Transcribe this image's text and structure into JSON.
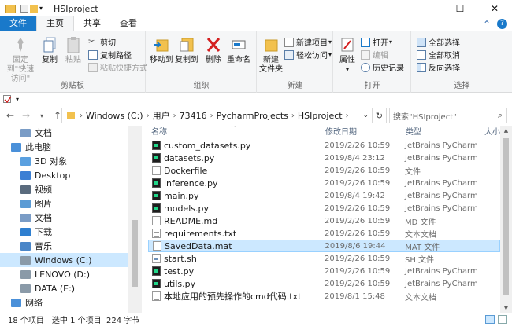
{
  "window": {
    "title": "HSIproject",
    "controls": {
      "minimize": "—",
      "maximize": "☐",
      "close": "✕"
    }
  },
  "ribbon_tabs": [
    "文件",
    "主页",
    "共享",
    "查看"
  ],
  "ribbon": {
    "clipboard": {
      "label": "剪贴板",
      "pin": "固定到\"快速访问\"",
      "copy": "复制",
      "paste": "粘贴",
      "cut": "剪切",
      "copy_path": "复制路径",
      "paste_shortcut": "粘贴快捷方式"
    },
    "organize": {
      "label": "组织",
      "move_to": "移动到",
      "copy_to": "复制到",
      "delete": "删除",
      "rename": "重命名"
    },
    "new": {
      "label": "新建",
      "new_folder": "新建\n文件夹",
      "new_item": "新建项目",
      "easy_access": "轻松访问"
    },
    "open": {
      "label": "打开",
      "properties": "属性",
      "open": "打开",
      "edit": "编辑",
      "history": "历史记录"
    },
    "select": {
      "label": "选择",
      "select_all": "全部选择",
      "select_none": "全部取消",
      "invert": "反向选择"
    }
  },
  "address": {
    "crumbs": [
      "Windows (C:)",
      "用户",
      "73416",
      "PycharmProjects",
      "HSIproject"
    ],
    "search_placeholder": "搜索\"HSIproject\""
  },
  "nav": [
    {
      "label": "文档",
      "icon": "documents-icon",
      "indent": 1,
      "selected": false
    },
    {
      "label": "此电脑",
      "icon": "computer-icon",
      "indent": 0,
      "selected": false
    },
    {
      "label": "3D 对象",
      "icon": "3d-objects-icon",
      "indent": 1,
      "selected": false
    },
    {
      "label": "Desktop",
      "icon": "desktop-icon",
      "indent": 1,
      "selected": false
    },
    {
      "label": "视频",
      "icon": "videos-icon",
      "indent": 1,
      "selected": false
    },
    {
      "label": "图片",
      "icon": "pictures-icon",
      "indent": 1,
      "selected": false
    },
    {
      "label": "文档",
      "icon": "documents-icon",
      "indent": 1,
      "selected": false
    },
    {
      "label": "下载",
      "icon": "downloads-icon",
      "indent": 1,
      "selected": false
    },
    {
      "label": "音乐",
      "icon": "music-icon",
      "indent": 1,
      "selected": false
    },
    {
      "label": "Windows (C:)",
      "icon": "drive-icon",
      "indent": 1,
      "selected": true
    },
    {
      "label": "LENOVO (D:)",
      "icon": "drive-icon",
      "indent": 1,
      "selected": false
    },
    {
      "label": "DATA (E:)",
      "icon": "drive-icon",
      "indent": 1,
      "selected": false
    },
    {
      "label": "网络",
      "icon": "network-icon",
      "indent": 0,
      "selected": false
    }
  ],
  "columns": {
    "name": "名称",
    "date": "修改日期",
    "type": "类型",
    "size": "大小"
  },
  "files": [
    {
      "name": "custom_datasets.py",
      "date": "2019/2/26 10:59",
      "type": "JetBrains PyCharm",
      "icon": "py",
      "selected": false
    },
    {
      "name": "datasets.py",
      "date": "2019/8/4 23:12",
      "type": "JetBrains PyCharm",
      "icon": "py",
      "selected": false
    },
    {
      "name": "Dockerfile",
      "date": "2019/2/26 10:59",
      "type": "文件",
      "icon": "doc",
      "selected": false
    },
    {
      "name": "inference.py",
      "date": "2019/2/26 10:59",
      "type": "JetBrains PyCharm",
      "icon": "py",
      "selected": false
    },
    {
      "name": "main.py",
      "date": "2019/8/4 19:42",
      "type": "JetBrains PyCharm",
      "icon": "py",
      "selected": false
    },
    {
      "name": "models.py",
      "date": "2019/2/26 10:59",
      "type": "JetBrains PyCharm",
      "icon": "py",
      "selected": false
    },
    {
      "name": "README.md",
      "date": "2019/2/26 10:59",
      "type": "MD 文件",
      "icon": "doc",
      "selected": false
    },
    {
      "name": "requirements.txt",
      "date": "2019/2/26 10:59",
      "type": "文本文档",
      "icon": "txt",
      "selected": false
    },
    {
      "name": "SavedData.mat",
      "date": "2019/8/6 19:44",
      "type": "MAT 文件",
      "icon": "doc",
      "selected": true
    },
    {
      "name": "start.sh",
      "date": "2019/2/26 10:59",
      "type": "SH 文件",
      "icon": "sh",
      "selected": false
    },
    {
      "name": "test.py",
      "date": "2019/2/26 10:59",
      "type": "JetBrains PyCharm",
      "icon": "py",
      "selected": false
    },
    {
      "name": "utils.py",
      "date": "2019/2/26 10:59",
      "type": "JetBrains PyCharm",
      "icon": "py",
      "selected": false
    },
    {
      "name": "本地应用的预先操作的cmd代码.txt",
      "date": "2019/8/1 15:48",
      "type": "文本文档",
      "icon": "txt",
      "selected": false
    }
  ],
  "status": {
    "count": "18 个项目",
    "selection": "选中 1 个项目  224 字节"
  },
  "colors": {
    "accent": "#1979ca",
    "selection": "#cce8ff",
    "selection_border": "#99d1ff"
  }
}
